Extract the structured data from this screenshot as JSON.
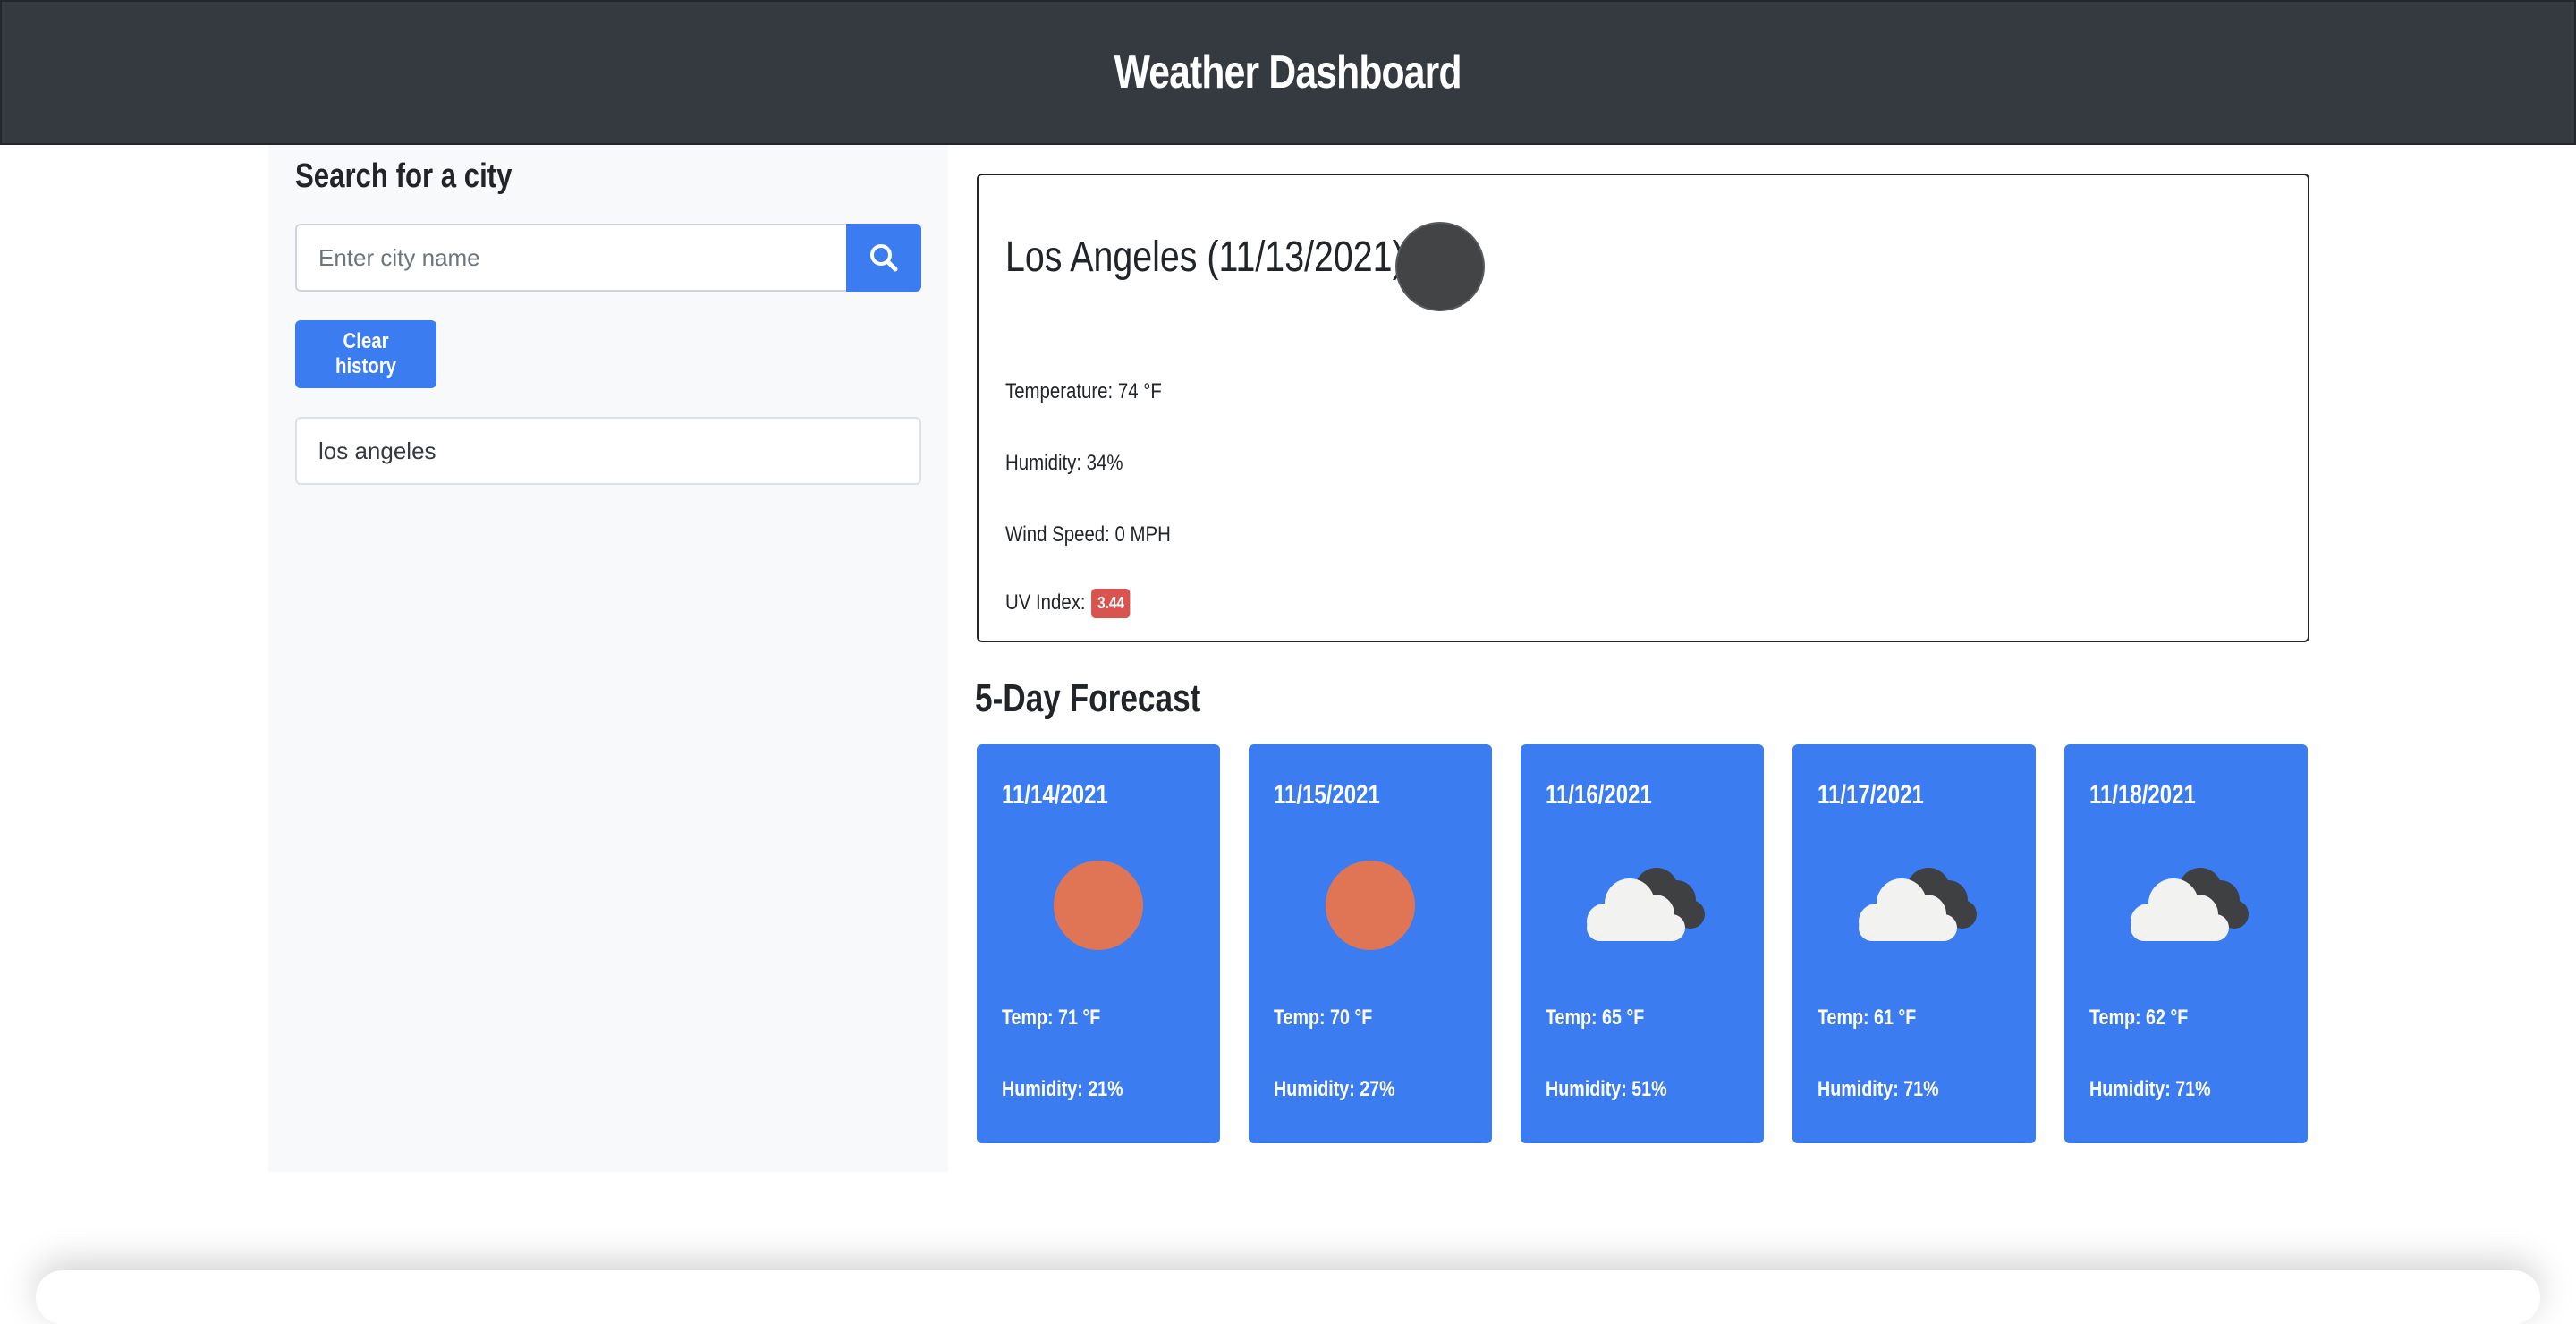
{
  "header": {
    "title": "Weather Dashboard"
  },
  "sidebar": {
    "heading": "Search for a city",
    "search": {
      "placeholder": "Enter city name",
      "value": ""
    },
    "clear_label": "Clear history",
    "history": [
      "los angeles"
    ]
  },
  "current": {
    "title": "Los Angeles (11/13/2021)",
    "icon": "moon-icon",
    "temperature": "Temperature: 74 °F",
    "humidity": "Humidity: 34%",
    "wind": "Wind Speed: 0 MPH",
    "uv_label": "UV Index:",
    "uv_value": "3.44",
    "uv_color": "#d9534f"
  },
  "forecast": {
    "heading": "5-Day Forecast",
    "accent": "#3b7cf1",
    "days": [
      {
        "date": "11/14/2021",
        "icon": "sun-icon",
        "temp": "Temp: 71 °F",
        "humidity": "Humidity: 21%"
      },
      {
        "date": "11/15/2021",
        "icon": "sun-icon",
        "temp": "Temp: 70 °F",
        "humidity": "Humidity: 27%"
      },
      {
        "date": "11/16/2021",
        "icon": "cloud-icon",
        "temp": "Temp: 65 °F",
        "humidity": "Humidity: 51%"
      },
      {
        "date": "11/17/2021",
        "icon": "cloud-icon",
        "temp": "Temp: 61 °F",
        "humidity": "Humidity: 71%"
      },
      {
        "date": "11/18/2021",
        "icon": "cloud-icon",
        "temp": "Temp: 62 °F",
        "humidity": "Humidity: 71%"
      }
    ]
  }
}
